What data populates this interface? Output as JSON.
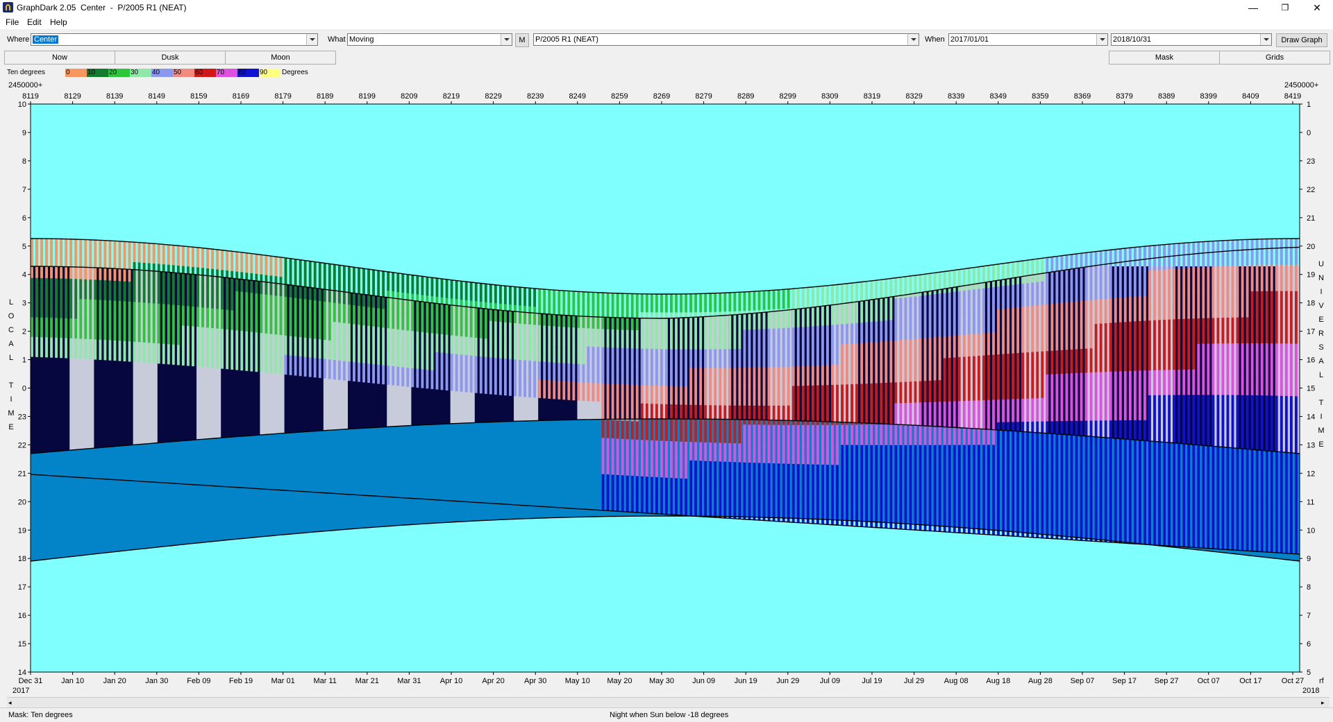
{
  "window": {
    "title": "GraphDark 2.05  Center  -  P/2005 R1 (NEAT)",
    "minimize": "—",
    "maximize": "❐",
    "close": "✕"
  },
  "menu": [
    "File",
    "Edit",
    "Help"
  ],
  "toolbar": {
    "where_label": "Where",
    "where_value": "Center",
    "what_label": "What",
    "what_value": "Moving",
    "m_button": "M",
    "object_value": "P/2005 R1 (NEAT)",
    "when_label": "When",
    "from_value": "2017/01/01",
    "to_value": "2018/10/31",
    "draw_button": "Draw Graph"
  },
  "row2": {
    "now": "Now",
    "dusk": "Dusk",
    "moon": "Moon",
    "mask": "Mask",
    "grids": "Grids"
  },
  "legend": {
    "label": "Ten degrees",
    "unit": "Degrees",
    "entries": [
      {
        "label": "0",
        "color": "#f7975f"
      },
      {
        "label": "10",
        "color": "#117d2c"
      },
      {
        "label": "20",
        "color": "#2cc63a"
      },
      {
        "label": "30",
        "color": "#8ee8a8"
      },
      {
        "label": "40",
        "color": "#8c97ef"
      },
      {
        "label": "50",
        "color": "#f28a80"
      },
      {
        "label": "60",
        "color": "#d01818"
      },
      {
        "label": "70",
        "color": "#e050e0"
      },
      {
        "label": "80",
        "color": "#1010d0"
      },
      {
        "label": "90",
        "color": "#ffff80"
      }
    ]
  },
  "colors": {
    "day": "#80ffff",
    "twilight": "#0484c8",
    "night": "#06073f",
    "moonlight": "#c8ccda"
  },
  "chart_data": {
    "type": "other",
    "title": "",
    "top_axis_prefix_left": "2450000+",
    "top_axis_prefix_right": "2450000+",
    "top_ticks": [
      "8119",
      "8129",
      "8139",
      "8149",
      "8159",
      "8169",
      "8179",
      "8189",
      "8199",
      "8209",
      "8219",
      "8229",
      "8239",
      "8249",
      "8259",
      "8269",
      "8279",
      "8289",
      "8299",
      "8309",
      "8319",
      "8329",
      "8339",
      "8349",
      "8359",
      "8369",
      "8379",
      "8389",
      "8399",
      "8409",
      "8419"
    ],
    "bottom_ticks": [
      "Dec 31",
      "Jan 10",
      "Jan 20",
      "Jan 30",
      "Feb 09",
      "Feb 19",
      "Mar 01",
      "Mar 11",
      "Mar 21",
      "Mar 31",
      "Apr 10",
      "Apr 20",
      "Apr 30",
      "May 10",
      "May 20",
      "May 30",
      "Jun 09",
      "Jun 19",
      "Jun 29",
      "Jul 09",
      "Jul 19",
      "Jul 29",
      "Aug 08",
      "Aug 18",
      "Aug 28",
      "Sep 07",
      "Sep 17",
      "Sep 27",
      "Oct 07",
      "Oct 17",
      "Oct 27"
    ],
    "bottom_year_left": "2017",
    "bottom_year_right": "2018",
    "bottom_right_extra": "rf",
    "left_ticks": [
      "10",
      "9",
      "8",
      "7",
      "6",
      "5",
      "4",
      "3",
      "2",
      "1",
      "0",
      "23",
      "22",
      "21",
      "20",
      "19",
      "18",
      "17",
      "16",
      "15",
      "14"
    ],
    "right_ticks": [
      "1",
      "0",
      "23",
      "22",
      "21",
      "20",
      "19",
      "18",
      "17",
      "16",
      "15",
      "14",
      "13",
      "12",
      "11",
      "10",
      "9",
      "8",
      "7",
      "6",
      "5"
    ],
    "left_axis_label": [
      "L",
      "O",
      "C",
      "A",
      "L",
      "",
      "T",
      "I",
      "M",
      "E"
    ],
    "right_axis_label": [
      "U",
      "N",
      "I",
      "V",
      "E",
      "R",
      "S",
      "A",
      "L",
      "",
      "T",
      "I",
      "M",
      "E"
    ]
  },
  "status": {
    "left": "Mask:  Ten degrees",
    "center": "Night when Sun below -18 degrees"
  }
}
